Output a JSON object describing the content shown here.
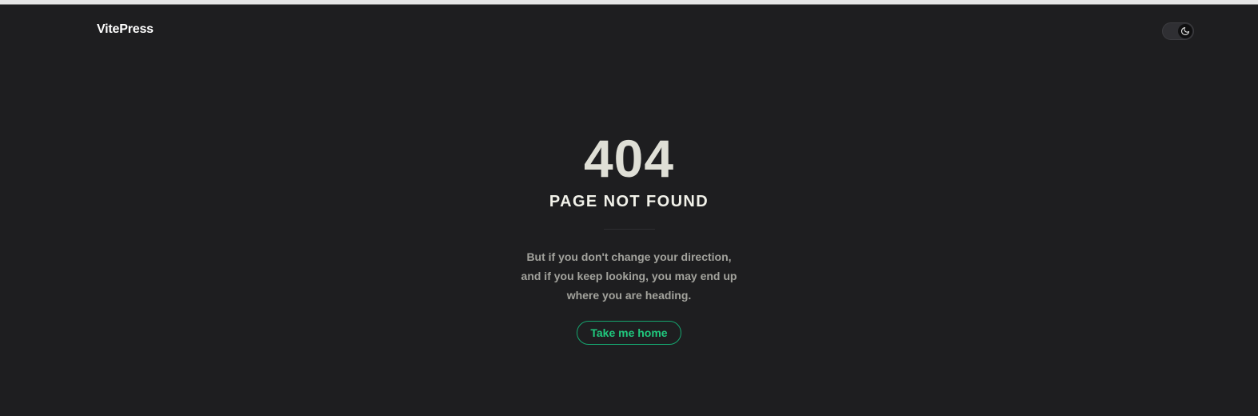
{
  "navbar": {
    "brand": "VitePress",
    "appearance_switch": {
      "icon": "moon-icon",
      "mode": "dark"
    }
  },
  "not_found": {
    "code": "404",
    "title": "PAGE NOT FOUND",
    "quote": "But if you don't change your direction, and if you keep looking, you may end up where you are heading.",
    "home_link": "Take me home"
  },
  "colors": {
    "background": "#1e1e20",
    "brand_green": "#20c97e",
    "text_primary": "#dfdfd6",
    "text_muted": "#a3a39d"
  }
}
